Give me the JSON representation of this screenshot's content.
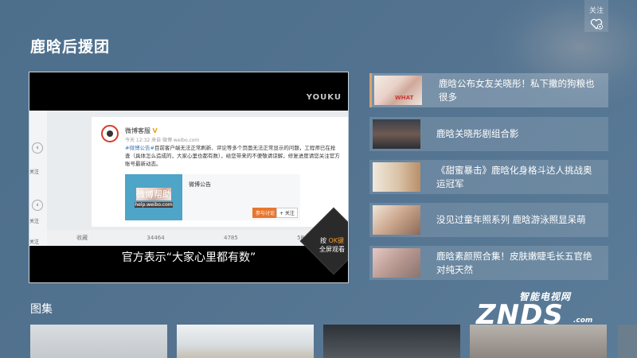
{
  "page": {
    "title": "鹿晗后援团"
  },
  "follow": {
    "label": "关注",
    "icon": "heart-icon"
  },
  "video": {
    "logo": "YOUKU",
    "subtitle": "官方表示“大家心里都有数”",
    "fullscreen": {
      "prefix": "按",
      "key": "OK键",
      "label": "全屏观看"
    },
    "weibo": {
      "account": "微博客服",
      "badge": "V",
      "time": "今天 12:32 来自 微博 weibo.com",
      "post_tag": "#微博公告#",
      "post_body": "目前客户端无法正常刷新、评论等多个页面无法正常显示的问题，工程师已在抢查（具体怎么造成的，大家心里也都有数），给您带来的不便敬请谅解，修复进度请您关注官方账号最新动态。",
      "card_logo": "微博帮助",
      "card_logo_sub": "help.weibo.com",
      "card_title": "微博公告",
      "join_label": "参与讨论",
      "follow_label": "+ 关注",
      "side_follow_1": "关注",
      "side_follow_2": "关注",
      "side_follow_3": "关注",
      "actions": [
        "收藏",
        "34464",
        "4785",
        "584188"
      ]
    }
  },
  "news": [
    {
      "title": "鹿晗公布女友关晓彤！私下撒的狗粮也很多",
      "thumb_text": "WHAT"
    },
    {
      "title": "鹿晗关晓彤剧组合影"
    },
    {
      "title": "《甜蜜暴击》鹿晗化身格斗达人挑战奥运冠军"
    },
    {
      "title": "没见过童年照系列 鹿晗游泳照显呆萌"
    },
    {
      "title": "鹿晗素颜照合集！皮肤嫩睫毛长五官绝对纯天然"
    }
  ],
  "gallery": {
    "title": "图集"
  },
  "watermark": {
    "cn": "智能电视网",
    "en": "ZNDS",
    "com": ".com"
  },
  "colors": {
    "background": "#52728f",
    "accent": "#d9a26a",
    "ok_key": "#f39a2b"
  }
}
